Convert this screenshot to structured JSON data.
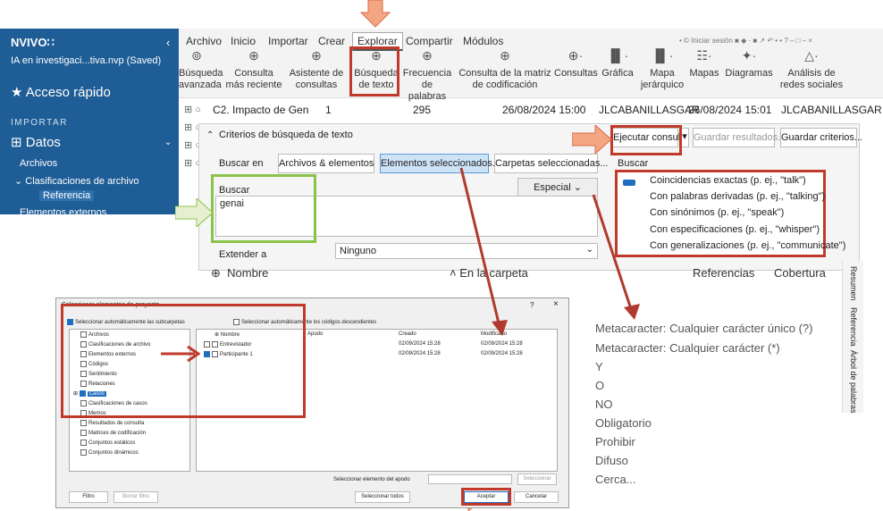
{
  "sidebar": {
    "app": "NVIVO∷",
    "project": "IA en investigaci...tiva.nvp (Saved)",
    "collapse": "‹",
    "quick_access": "Acceso rápido",
    "import_header": "IMPORTAR",
    "data_label": "Datos",
    "archivos": "Archivos",
    "clasif": "Clasificaciones de archivo",
    "referencia": "Referencia",
    "externos": "Elementos externos"
  },
  "menu": [
    "Archivo",
    "Inicio",
    "Importar",
    "Crear",
    "Explorar",
    "Compartir",
    "Módulos"
  ],
  "window_controls": "• © Iniciar sesión  ■ ◆ · ■ ↗ ↶ • • ? – □ – ×",
  "ribbon": [
    {
      "l1": "Búsqueda",
      "l2": "avanzada",
      "icon": "⊚"
    },
    {
      "l1": "Consulta",
      "l2": "más reciente",
      "icon": "⊕"
    },
    {
      "l1": "Asistente de",
      "l2": "consultas",
      "icon": "⊕"
    },
    {
      "l1": "Búsqueda",
      "l2": "de texto",
      "icon": "⊕"
    },
    {
      "l1": "Frecuencia",
      "l2": "de palabras",
      "icon": "⊕"
    },
    {
      "l1": "Consulta de la matriz",
      "l2": "de codificación",
      "icon": "⊕"
    },
    {
      "l1": "Consultas",
      "l2": "",
      "icon": "⊕·"
    },
    {
      "l1": "Gráfica",
      "l2": "",
      "icon": "▐▌·"
    },
    {
      "l1": "Mapa",
      "l2": "jerárquico",
      "icon": "▐▌·"
    },
    {
      "l1": "Mapas",
      "l2": "",
      "icon": "☷·"
    },
    {
      "l1": "Diagramas",
      "l2": "",
      "icon": "✦·"
    },
    {
      "l1": "Análisis de",
      "l2": "redes sociales",
      "icon": "△·"
    }
  ],
  "table_row": {
    "name": "C2. Impacto de Gen",
    "refs": "1",
    "count": "295",
    "date": "26/08/2024 15:00",
    "user": "JLCABANILLASGAR",
    "date2": "26/08/2024 15:01",
    "user2": "JLCABANILLASGAR"
  },
  "panel": {
    "title": "Criterios de búsqueda de texto",
    "run": "Ejecutar consulta",
    "save_results": "Guardar resultados...",
    "save_criteria": "Guardar criterios...",
    "search_in": "Buscar en",
    "btn_archivos": "Archivos & elementos",
    "btn_elementos": "Elementos seleccionados...",
    "btn_carpetas": "Carpetas seleccionadas...",
    "buscar": "Buscar",
    "buscar_right": "Buscar",
    "especial": "Especial",
    "query": "genai",
    "extend": "Extender a",
    "extend_val": "Ninguno"
  },
  "options": [
    "Coincidencias exactas (p. ej., \"talk\")",
    "Con palabras derivadas (p. ej., \"talking\")",
    "Con sinónimos (p. ej., \"speak\")",
    "Con especificaciones (p. ej., \"whisper\")",
    "Con generalizaciones (p. ej., \"communicate\")"
  ],
  "headers": {
    "nombre": "Nombre",
    "carpeta": "En la carpeta",
    "refs": "Referencias",
    "cob": "Cobertura"
  },
  "side_tabs": [
    "Resumen",
    "Referencia",
    "Árbol de palabras"
  ],
  "metas": [
    "Metacaracter: Cualquier carácter único (?)",
    "Metacaracter: Cualquier carácter (*)",
    "Y",
    "O",
    "NO",
    "Obligatorio",
    "Prohibir",
    "Difuso",
    "Cerca..."
  ],
  "dialog": {
    "title": "Seleccionar elementos de proyecto",
    "help": "?",
    "close": "×",
    "sub": "Seleccionar automáticamente las subcarpetas",
    "desc": "Seleccionar automáticamente los códigos descendientes",
    "tree": [
      "Archivos",
      "Clasificaciones de archivo",
      "Elementos externos",
      "Códigos",
      "Sentimiento",
      "Relaciones",
      "Casos",
      "Clasificaciones de casos",
      "Memos",
      "Resultados de consulta",
      "Matrices de codificación",
      "Conjuntos estáticos",
      "Conjuntos dinámicos"
    ],
    "cols": [
      "Nombre",
      "Apodo",
      "Creado",
      "Modificado"
    ],
    "rows": [
      {
        "name": "Entrevistador",
        "created": "02/09/2024 15:28",
        "modified": "02/09/2024 15:28"
      },
      {
        "name": "Participante 1",
        "created": "02/09/2024 15:28",
        "modified": "02/09/2024 15:28"
      }
    ],
    "filter": "Filtro",
    "clear": "Borrar filtro",
    "apodo_lbl": "Seleccionar elemento del apodo",
    "select": "Seleccionar",
    "select_all": "Seleccionar todos",
    "accept": "Aceptar",
    "cancel": "Cancelar"
  },
  "colors": {
    "sidebar": "#1f5d96",
    "red": "#c0392b",
    "green": "#8bc34a",
    "arrow": "#f4a582"
  }
}
